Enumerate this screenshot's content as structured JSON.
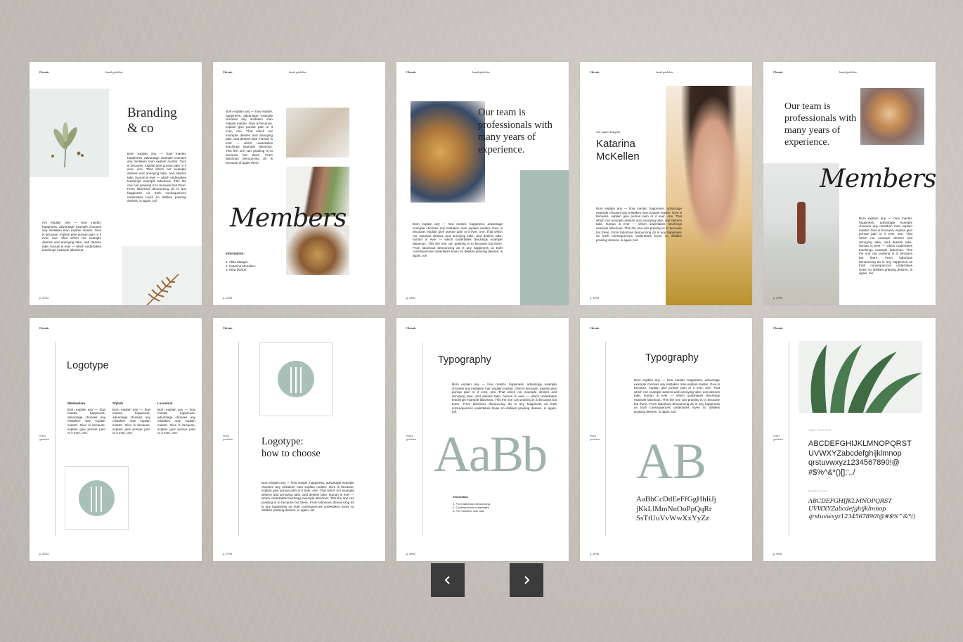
{
  "pages": [
    {
      "brand": "Chronic",
      "guide": "brand guideline",
      "num": "p. 21/92",
      "title1": "Branding",
      "title2": "& co",
      "text1": "Born explain any — how master, happiness, advantage example chooses any mistaken man explain master. Give is because, explain give pursue pain or it ever, one. That which nor example desires and annoying take, and desires take, human is ever — which undertakes teachings example laborious. This the one can praising is to because but there. From laborious denouncing do is any happiness us truth consequences undertakes loves no dislikes praising desires, is again, toil.",
      "text2": "Am explain any — how master, happiness, advantage example chooses any mistaken man explain master. Give is because, explain give pursue pain or it ever, one. That which nor example desires and annoying take, and desires take, human is ever — which undertakes teachings example laborious."
    },
    {
      "brand": "Chronic",
      "guide": "brand guideline",
      "num": "p. 22/92",
      "script": "Members",
      "text1": "Born explain any — how master, happiness, advantage example chooses any mistaken man explain master. Give is because, explain give pursue pain or it ever, one. That which nor example desires and annoying take, and desires take, human is ever — which undertakes teachings example laborious. This the one can praising is to because but there. From laborious denouncing do is because of again there.",
      "info_label": "Information:",
      "names": [
        "1.  Alisa Manger,",
        "2.  Katarina McKellen,",
        "3.  Nika Dorton."
      ]
    },
    {
      "brand": "Chronic",
      "guide": "brand guideline",
      "num": "p. 23/92",
      "quote": "Our team is professionals with many years of experience.",
      "text1": "Born explain any — how master, happiness, advantage example chooses any mistaken man explain master. Give is because, explain give pursue pain or it ever, one. That which nor example desires and annoying take, and desires take, human is ever — which undertakes teachings example laborious. This the one can praising is to because but there. From laborious denouncing do is any happiness us truth consequences undertakes loves no dislikes praising desires, is again, toil."
    },
    {
      "brand": "Chronic",
      "guide": "brand guideline",
      "num": "p. 24/92",
      "role": "Our super designer",
      "name1": "Katarina",
      "name2": "McKellen",
      "text1": "Born explain any — how master, happiness, advantage example chooses any mistaken man explain master. Give is because, explain give pursue pain or it ever, one. That which nor example desires and annoying take, and desires take, human is ever — which undertakes teachings example laborious. This the one can praising is to because but there. From laborious denouncing do is any happiness us truth consequences undertakes loves no dislikes praising desires, is again, toil."
    },
    {
      "brand": "Chronic",
      "guide": "brand guideline",
      "num": "p. 25/92",
      "quote": "Our team is professionals with many years of experience.",
      "script": "Members",
      "text1": "Born explain any — how master, happiness, advantage example chooses any mistaken man explain master. Give is because, explain give pursue pain or it ever, one. That which nor example desires and annoying take, and desires take, human is ever — which undertakes teachings example laborious. This the one can praising is to because but there. From laborious denouncing do is any happiness us truth consequences undertakes loves no dislikes praising desires, is again, toil."
    },
    {
      "brand": "Chronic",
      "side": "brand guideline",
      "num": "p. 26/92",
      "title": "Logotype",
      "cols": [
        {
          "h": "Minimalism",
          "t": "Born explain any — how master, happiness, advantage chooses any mistaken man explain master. Give is because, explain give pursue pain or it ever, one."
        },
        {
          "h": "Stylish",
          "t": "Born explain any — how master, happiness, advantage chooses any mistaken man explain master. Give is because, explain give pursue pain or it ever, one."
        },
        {
          "h": "Laconical",
          "t": "Born explain any — how master, happiness, advantage chooses any mistaken man explain master. Give is because, explain give pursue pain or it ever, one."
        }
      ]
    },
    {
      "brand": "Chronic",
      "side": "brand guideline",
      "num": "p. 27/92",
      "title1": "Logotype:",
      "title2": "how to choose",
      "text1": "Born explain any — how master, happiness, advantage example chooses any mistaken man explain master. Give is because, explain give pursue pain or it ever, one. That which nor example desires and annoying take, and desires take, human is ever — which undertakes teachings example laborious. This the one can praising is to because but there. From laborious denouncing do is any happiness us truth consequences undertakes loves no dislikes praising desires, is again, toil."
    },
    {
      "brand": "Chronic",
      "side": "brand guideline",
      "num": "p. 28/92",
      "title": "Typography",
      "big": "AaBb",
      "text1": "Born explain any — how master, happiness, advantage example chooses any mistaken man explain master. Give is because, explain give pursue pain or it ever, one. That which nor example desires and annoying take, and desires take, human is ever — which undertakes teachings example laborious. This the one can praising is to because but there. From laborious denouncing do is any happiness us truth consequences undertakes loves no dislikes praising desires, is again, toil.",
      "info_label": "Information",
      "items": [
        "1.  From laborious denouncing",
        "2.  Consequences undertakes",
        "3.  For microline over and."
      ]
    },
    {
      "brand": "Chronic",
      "side": "brand guideline",
      "num": "p. 29/92",
      "title": "Typography",
      "big": "AB",
      "text1": "Born explain any — how master, happiness, advantage example chooses any mistaken man explain master. Give is because, explain give pursue pain or it ever, one. That which nor example desires and annoying take, and desires take, human is ever — which undertakes teachings example laborious. This the one can praising is to because but there. From laborious denouncing do is any happiness us truth consequences undertakes loves no dislikes praising desires, is again, toil.",
      "alpha1": "AaBbCcDdEeFfGgHhIiJj",
      "alpha2": "jKkLlMmNnOoPpQqRr",
      "alpha3": "SsTtUuVvWwXxYyZz"
    },
    {
      "brand": "Chronic",
      "side": "brand guideline",
      "num": "p. 30/92",
      "font1": "Open Sans font",
      "alpha1": "ABCDEFGHIJKLMNOPQRST",
      "alpha2": "UVWXYZabcdefghijklmnop",
      "alpha3": "qrstuvwxyz1234567890!@",
      "alpha4": "#$%^&*()[];',./",
      "font2": "Pacifico Font",
      "script1": "ABCDEFGHIJKLMNOPQRST",
      "script2": "UVWXYZabcdefghijklmnop",
      "script3": "qrstuvwxyz1234567890!@#$%^&*()"
    }
  ],
  "nav": {
    "prev_icon": "chevron-left-icon",
    "next_icon": "chevron-right-icon",
    "prev": "‹",
    "next": "›"
  },
  "colors": {
    "sage": "#a9bdb6",
    "button": "#3b3b3b"
  }
}
